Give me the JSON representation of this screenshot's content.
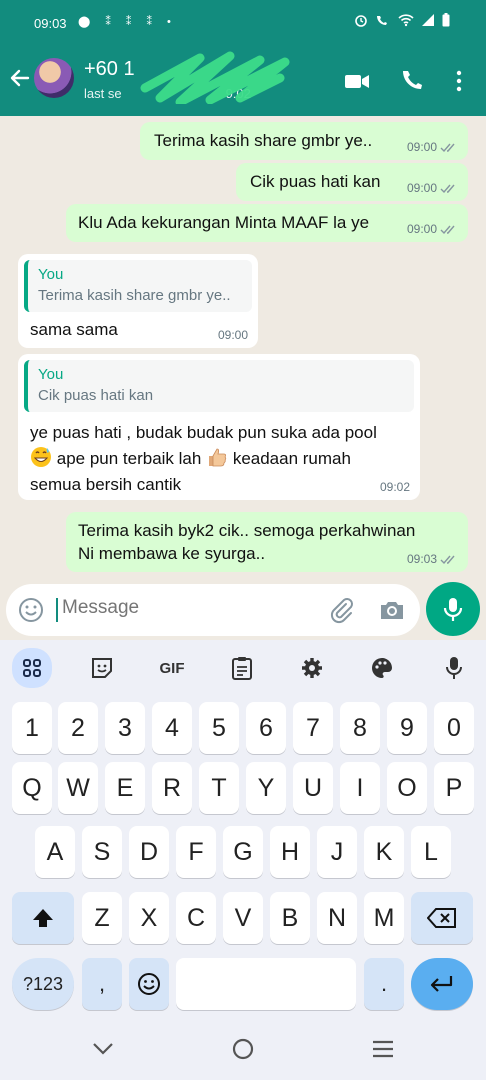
{
  "status_bar": {
    "time": "09:03"
  },
  "header": {
    "contact_name": "+60 1",
    "contact_subtitle": "last se",
    "subtitle_time_fragment": "9:02"
  },
  "messages": [
    {
      "direction": "out",
      "text": "Terima kasih share gmbr ye..",
      "time": "09:00",
      "ticks": "read"
    },
    {
      "direction": "out",
      "text": "Cik puas hati kan",
      "time": "09:00",
      "ticks": "read"
    },
    {
      "direction": "out",
      "text": "Klu Ada kekurangan Minta MAAF la ye",
      "time": "09:00",
      "ticks": "read"
    },
    {
      "direction": "in",
      "quote_author": "You",
      "quote_text": "Terima kasih share gmbr ye..",
      "text": "sama sama",
      "time": "09:00"
    },
    {
      "direction": "in",
      "quote_author": "You",
      "quote_text": "Cik puas hati kan",
      "text_line1": "ye puas hati , budak budak pun suka ada pool",
      "text_line2": "ape pun terbaik lah",
      "text_line3": "keadaan rumah",
      "text_line4": "semua bersih cantik",
      "emojis": [
        "grinning-sweat-emoji",
        "thumbs-up-emoji"
      ],
      "time": "09:02"
    },
    {
      "direction": "out",
      "text_line1": "Terima kasih byk2 cik.. semoga perkahwinan",
      "text_line2": "Ni membawa ke syurga..",
      "time": "09:03",
      "ticks": "read"
    }
  ],
  "input": {
    "placeholder": "Message"
  },
  "keyboard": {
    "toolbar": [
      "apps-icon",
      "sticker-icon",
      "GIF",
      "clipboard-icon",
      "settings-icon",
      "palette-icon",
      "mic-icon"
    ],
    "gif_label": "GIF",
    "row_numbers": [
      "1",
      "2",
      "3",
      "4",
      "5",
      "6",
      "7",
      "8",
      "9",
      "0"
    ],
    "row_q": [
      "Q",
      "W",
      "E",
      "R",
      "T",
      "Y",
      "U",
      "I",
      "O",
      "P"
    ],
    "row_a": [
      "A",
      "S",
      "D",
      "F",
      "G",
      "H",
      "J",
      "K",
      "L"
    ],
    "row_z": [
      "Z",
      "X",
      "C",
      "V",
      "B",
      "N",
      "M"
    ],
    "symbols_key": "?123",
    "comma_key": ",",
    "period_key": "."
  },
  "colors": {
    "header": "#128c7e",
    "accent": "#00a884",
    "outgoing_bubble": "#d9fdd3",
    "chat_bg": "#efeae2",
    "keyboard_bg": "#eef0f7"
  }
}
